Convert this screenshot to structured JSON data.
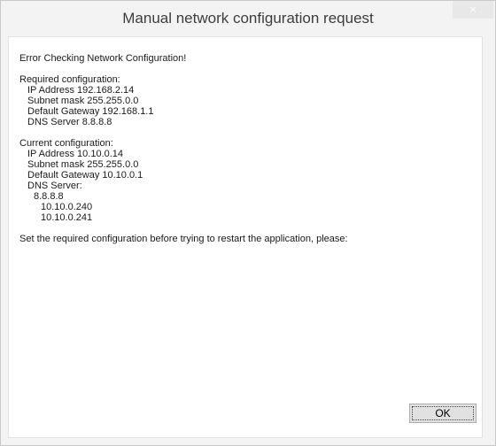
{
  "window": {
    "title": "Manual network configuration request",
    "close_glyph": "×"
  },
  "message": {
    "heading": "Error Checking Network Configuration!",
    "required": {
      "label": "Required configuration:",
      "ip": "IP Address 192.168.2.14",
      "subnet": "Subnet mask 255.255.0.0",
      "gateway": "Default Gateway 192.168.1.1",
      "dns": "DNS Server 8.8.8.8"
    },
    "current": {
      "label": "Current configuration:",
      "ip": "IP Address 10.10.0.14",
      "subnet": "Subnet mask 255.255.0.0",
      "gateway": "Default Gateway 10.10.0.1",
      "dns_label": "DNS Server:",
      "dns_servers": [
        "8.8.8.8",
        "10.10.0.240",
        "10.10.0.241"
      ]
    },
    "instruction": "Set the required configuration before trying to restart the application, please:"
  },
  "buttons": {
    "ok_label": "OK"
  }
}
